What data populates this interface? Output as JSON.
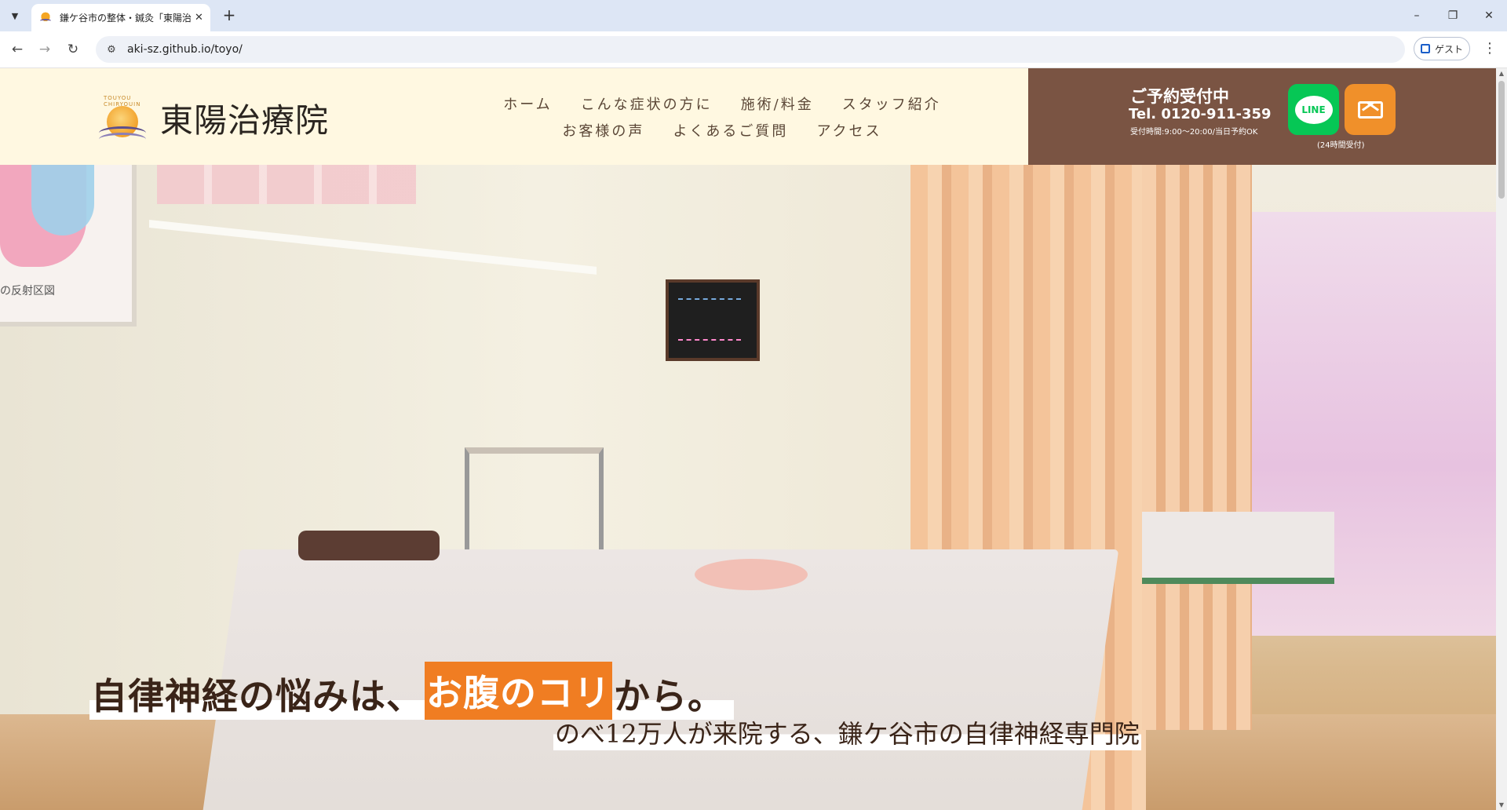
{
  "browser": {
    "tab_title": "鎌ケ谷市の整体・鍼灸「東陽治療院」",
    "url": "aki-sz.github.io/toyo/",
    "guest_label": "ゲスト",
    "tab_list_icon": "chevron-down-icon",
    "new_tab_label": "+",
    "minimize_label": "–",
    "restore_label": "❐",
    "close_label": "✕",
    "back_label": "←",
    "forward_label": "→",
    "reload_label": "↻",
    "menu_label": "⋮",
    "tab_close_label": "✕"
  },
  "site": {
    "logo_text": "東陽治療院",
    "logo_arc_text": "TOUYOU CHIRYOUIN",
    "nav_row1": [
      "ホーム",
      "こんな症状の方に",
      "施術/料金",
      "スタッフ紹介"
    ],
    "nav_row2": [
      "お客様の声",
      "よくあるご質問",
      "アクセス"
    ],
    "reserve": {
      "title": "ご予約受付中",
      "tel": "Tel. 0120-911-359",
      "hours": "受付時間:9:00〜20:00/当日予約OK",
      "line_label": "LINE",
      "note": "(24時間受付)"
    }
  },
  "hero": {
    "catch_part1": "自律神経の悩みは、",
    "catch_highlight": "お腹のコリ",
    "catch_part2": "から。",
    "subtitle": "のべ12万人が来院する、鎌ケ谷市の自律神経専門院",
    "chart_caption": "の反射区図"
  },
  "colors": {
    "header_bg": "#fff8e1",
    "reserve_bg": "#7a5443",
    "line_green": "#06c755",
    "mail_orange": "#f0902a",
    "highlight_orange": "#f07d22"
  }
}
